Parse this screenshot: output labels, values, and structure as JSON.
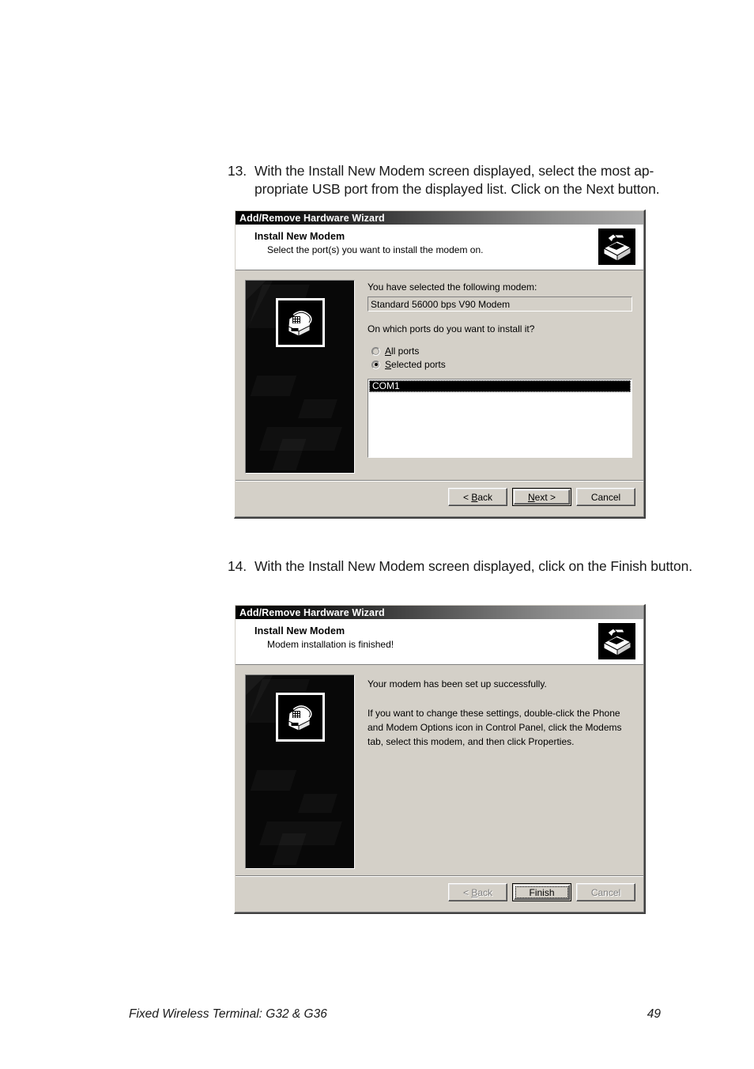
{
  "document": {
    "steps": [
      {
        "number": "13.",
        "text": "With the Install New Modem screen displayed, select the most ap-propriate USB port from the displayed list.  Click on the Next button."
      },
      {
        "number": "14.",
        "text": "With the Install New Modem screen displayed, click on the Finish button."
      }
    ],
    "footer": {
      "left": "Fixed Wireless Terminal: G32 & G36",
      "page_number": "49"
    }
  },
  "dialog_one": {
    "titlebar": "Add/Remove Hardware Wizard",
    "header": {
      "title": "Install New Modem",
      "subtitle": "Select the port(s) you want to install the modem on.",
      "icon": "add-remove-hardware-icon"
    },
    "art_icon": "modem-telephone-icon",
    "selected_modem_label": "You have selected the following modem:",
    "selected_modem_value": "Standard 56000 bps V90 Modem",
    "ports_question": "On which ports do you want to install it?",
    "radios": [
      {
        "label": "All ports",
        "accel": "A",
        "checked": false
      },
      {
        "label": "Selected ports",
        "accel": "S",
        "checked": true
      }
    ],
    "port_list": [
      {
        "name": "COM1",
        "selected": true
      }
    ],
    "buttons": [
      {
        "label": "< Back",
        "accel": "B",
        "default": false,
        "disabled": false,
        "focused": false
      },
      {
        "label": "Next >",
        "accel": "N",
        "default": true,
        "disabled": false,
        "focused": false
      },
      {
        "label": "Cancel",
        "accel": "",
        "default": false,
        "disabled": false,
        "focused": false
      }
    ]
  },
  "dialog_two": {
    "titlebar": "Add/Remove Hardware Wizard",
    "header": {
      "title": "Install New Modem",
      "subtitle": "Modem installation is finished!",
      "icon": "add-remove-hardware-icon"
    },
    "art_icon": "modem-telephone-icon",
    "body_paragraphs": [
      "Your modem has been set up successfully.",
      "If you want to change these settings, double-click the Phone and Modem Options icon in Control Panel, click the Modems tab, select this modem, and then click Properties."
    ],
    "buttons": [
      {
        "label": "< Back",
        "accel": "B",
        "default": false,
        "disabled": true,
        "focused": false
      },
      {
        "label": "Finish",
        "accel": "",
        "default": true,
        "disabled": false,
        "focused": true
      },
      {
        "label": "Cancel",
        "accel": "",
        "default": false,
        "disabled": true,
        "focused": false
      }
    ]
  }
}
